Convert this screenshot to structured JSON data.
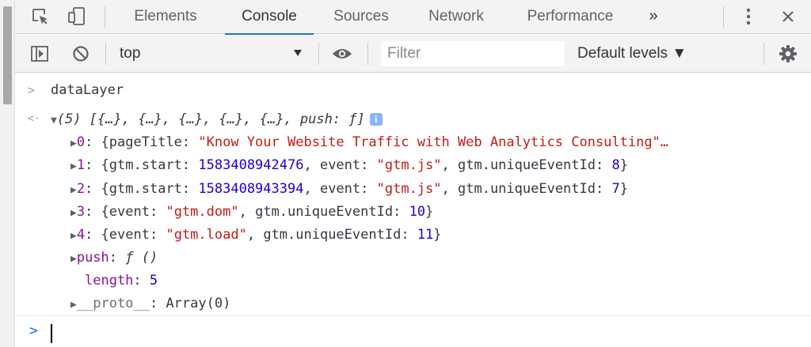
{
  "tabs": {
    "items": [
      {
        "label": "Elements"
      },
      {
        "label": "Console"
      },
      {
        "label": "Sources"
      },
      {
        "label": "Network"
      },
      {
        "label": "Performance"
      }
    ],
    "more_label": "»"
  },
  "toolbar": {
    "context": "top",
    "filter_placeholder": "Filter",
    "levels_label": "Default levels ▼"
  },
  "console": {
    "input_command": "dataLayer",
    "summary": {
      "count": "(5)",
      "preview": "[{…}, {…}, {…}, {…}, {…}, push: ƒ]",
      "badge": "i"
    },
    "rows": [
      {
        "index": "0",
        "page_title_key": "pageTitle",
        "page_title_value": "\"Know Your Website Traffic with Web Analytics Consulting\"…"
      },
      {
        "index": "1",
        "start_key": "gtm.start",
        "start_value": "1583408942476",
        "event_key": "event",
        "event_value": "\"gtm.js\"",
        "id_key": "gtm.uniqueEventId",
        "id_value": "8"
      },
      {
        "index": "2",
        "start_key": "gtm.start",
        "start_value": "1583408943394",
        "event_key": "event",
        "event_value": "\"gtm.js\"",
        "id_key": "gtm.uniqueEventId",
        "id_value": "7"
      },
      {
        "index": "3",
        "event_key": "event",
        "event_value": "\"gtm.dom\"",
        "id_key": "gtm.uniqueEventId",
        "id_value": "10"
      },
      {
        "index": "4",
        "event_key": "event",
        "event_value": "\"gtm.load\"",
        "id_key": "gtm.uniqueEventId",
        "id_value": "11"
      }
    ],
    "push": {
      "key": "push",
      "value": "ƒ ()"
    },
    "length": {
      "key": "length",
      "value": "5"
    },
    "proto": {
      "key": "__proto__",
      "value": "Array(0)"
    }
  },
  "icons": {
    "inspect": "inspect-element-icon",
    "device": "device-toolbar-icon",
    "menu": "kebab-menu-icon",
    "close": "close-icon",
    "sidebar": "show-sidebar-icon",
    "clear": "clear-console-icon",
    "eye": "live-expression-icon",
    "settings": "gear-icon"
  },
  "colors": {
    "accent": "#1a73e8",
    "key": "#881391",
    "string": "#c41a16",
    "number": "#1c00cf"
  }
}
